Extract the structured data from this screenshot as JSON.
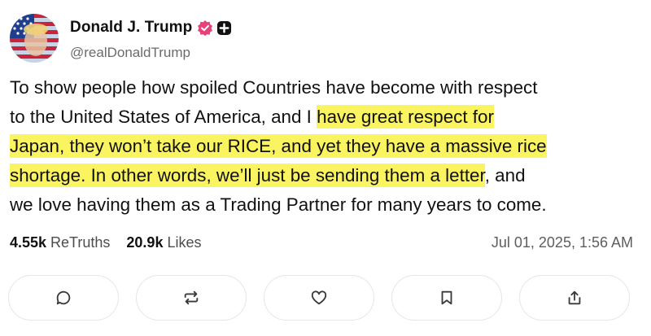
{
  "post": {
    "author": {
      "display_name": "Donald J. Trump",
      "handle": "@realDonaldTrump",
      "avatar_icon": "avatar-american-flag-portrait",
      "verified_icon": "verified-badge-icon",
      "verified_color": "#e8417a",
      "plus_icon": "plus-badge-icon"
    },
    "text_lines": [
      {
        "plain": "To show people how spoiled Countries have become with respect",
        "highlight": "",
        "after": ""
      },
      {
        "plain": "to the United States of America, and I ",
        "highlight": "have great respect for",
        "after": ""
      },
      {
        "plain": "",
        "highlight": "Japan, they won’t take our RICE, and yet they have a massive rice",
        "after": ""
      },
      {
        "plain": "",
        "highlight": "shortage. In other words, we’ll just be sending them a letter",
        "after": ", and"
      },
      {
        "plain": "we love having them as a Trading Partner for many years to come.",
        "highlight": "",
        "after": ""
      }
    ],
    "highlight_color": "#fbf461",
    "stats": {
      "retruths_count": "4.55k",
      "retruths_label": "ReTruths",
      "likes_count": "20.9k",
      "likes_label": "Likes"
    },
    "timestamp": "Jul 01, 2025, 1:56 AM",
    "actions": [
      {
        "name": "reply-button",
        "icon": "comment-icon"
      },
      {
        "name": "retruth-button",
        "icon": "repost-icon"
      },
      {
        "name": "like-button",
        "icon": "heart-icon"
      },
      {
        "name": "bookmark-button",
        "icon": "bookmark-icon"
      },
      {
        "name": "share-button",
        "icon": "share-icon"
      }
    ]
  }
}
